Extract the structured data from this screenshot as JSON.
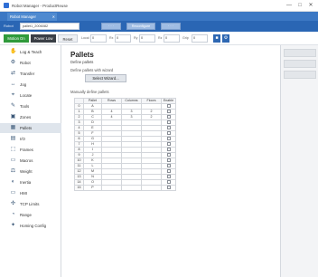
{
  "window": {
    "title": "Robot Manager - ProductReuse",
    "controls": [
      "—",
      "□",
      "✕"
    ]
  },
  "tab": {
    "label": "Robot Manager",
    "close": "✕"
  },
  "address": {
    "label": "Robot",
    "value": "pallet1_2006082",
    "buttons": [
      "· · ·",
      "Reconfigure",
      "· · ·"
    ]
  },
  "toolbar": {
    "primary": "Motion On",
    "secondary": "Power Low",
    "third": "Reset",
    "fields": [
      {
        "label": "Local",
        "value": "0"
      },
      {
        "label": "Rx",
        "value": "0"
      },
      {
        "label": "Ry",
        "value": "0"
      },
      {
        "label": "Rz",
        "value": "0"
      },
      {
        "label": "Grip",
        "value": "0"
      }
    ],
    "icons": [
      "stop-icon",
      "settings-icon"
    ],
    "icon_glyphs": [
      "■",
      "⚙"
    ]
  },
  "sidebar": {
    "items": [
      {
        "label": "Log & Teach",
        "icon": "hand-icon",
        "glyph": "✋",
        "active": false
      },
      {
        "label": "Robot",
        "icon": "robot-arm-icon",
        "glyph": "⚙",
        "active": false
      },
      {
        "label": "Transfer",
        "icon": "transfer-icon",
        "glyph": "⇄",
        "active": false
      },
      {
        "label": "Jog",
        "icon": "jog-icon",
        "glyph": "↔",
        "active": false
      },
      {
        "label": "Locate",
        "icon": "locate-icon",
        "glyph": "⌖",
        "active": false
      },
      {
        "label": "Tools",
        "icon": "tools-icon",
        "glyph": "✎",
        "active": false
      },
      {
        "label": "Zones",
        "icon": "zones-icon",
        "glyph": "▣",
        "active": false
      },
      {
        "label": "Pallets",
        "icon": "pallets-icon",
        "glyph": "▦",
        "active": true
      },
      {
        "label": "I/O",
        "icon": "io-icon",
        "glyph": "▤",
        "active": false
      },
      {
        "label": "Frames",
        "icon": "frames-icon",
        "glyph": "⬚",
        "active": false
      },
      {
        "label": "Macros",
        "icon": "macros-icon",
        "glyph": "▭",
        "active": false
      },
      {
        "label": "Weight",
        "icon": "weight-icon",
        "glyph": "⚖",
        "active": false
      },
      {
        "label": "Inertia",
        "icon": "inertia-icon",
        "glyph": "◐",
        "active": false
      },
      {
        "label": "HMI",
        "icon": "hmi-icon",
        "glyph": "▭",
        "active": false
      },
      {
        "label": "TCP Limits",
        "icon": "limits-icon",
        "glyph": "✣",
        "active": false
      },
      {
        "label": "Range",
        "icon": "range-icon",
        "glyph": "◔",
        "active": false
      },
      {
        "label": "Homing Config",
        "icon": "homing-icon",
        "glyph": "✦",
        "active": false
      }
    ]
  },
  "main": {
    "title": "Pallets",
    "subtitle": "Define pallets",
    "wizard_label": "Define pallets with wizard",
    "select_button": "Select Wizard...",
    "manual_label": "Manually define pallets",
    "table": {
      "headers": [
        "",
        "Pallet",
        "Rows",
        "Columns",
        "Floors",
        "Enable"
      ],
      "rows": [
        {
          "idx": "0",
          "name": "A",
          "rows": "",
          "cols": "",
          "floors": "",
          "enabled": false
        },
        {
          "idx": "1",
          "name": "B",
          "rows": "4",
          "cols": "3",
          "floors": "2",
          "enabled": false
        },
        {
          "idx": "2",
          "name": "C",
          "rows": "4",
          "cols": "3",
          "floors": "2",
          "enabled": false
        },
        {
          "idx": "3",
          "name": "D",
          "rows": "",
          "cols": "",
          "floors": "",
          "enabled": false
        },
        {
          "idx": "4",
          "name": "E",
          "rows": "",
          "cols": "",
          "floors": "",
          "enabled": false
        },
        {
          "idx": "5",
          "name": "F",
          "rows": "",
          "cols": "",
          "floors": "",
          "enabled": false
        },
        {
          "idx": "6",
          "name": "G",
          "rows": "",
          "cols": "",
          "floors": "",
          "enabled": false
        },
        {
          "idx": "7",
          "name": "H",
          "rows": "",
          "cols": "",
          "floors": "",
          "enabled": false
        },
        {
          "idx": "8",
          "name": "I",
          "rows": "",
          "cols": "",
          "floors": "",
          "enabled": false
        },
        {
          "idx": "9",
          "name": "J",
          "rows": "",
          "cols": "",
          "floors": "",
          "enabled": false
        },
        {
          "idx": "10",
          "name": "K",
          "rows": "",
          "cols": "",
          "floors": "",
          "enabled": false
        },
        {
          "idx": "11",
          "name": "L",
          "rows": "",
          "cols": "",
          "floors": "",
          "enabled": false
        },
        {
          "idx": "12",
          "name": "M",
          "rows": "",
          "cols": "",
          "floors": "",
          "enabled": false
        },
        {
          "idx": "13",
          "name": "N",
          "rows": "",
          "cols": "",
          "floors": "",
          "enabled": false
        },
        {
          "idx": "14",
          "name": "O",
          "rows": "",
          "cols": "",
          "floors": "",
          "enabled": false
        },
        {
          "idx": "15",
          "name": "P",
          "rows": "",
          "cols": "",
          "floors": "",
          "enabled": false
        }
      ]
    }
  },
  "colors": {
    "accent_blue": "#3c78c4",
    "motion_green": "#2f9a3b",
    "power_dark": "#3a3f46",
    "active_nav": "#dfe5ec"
  }
}
